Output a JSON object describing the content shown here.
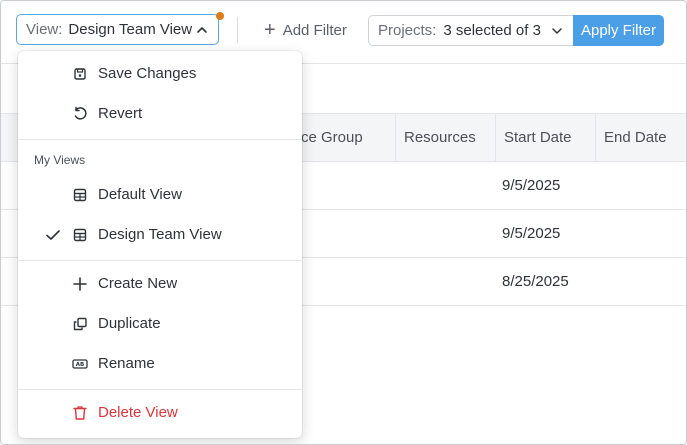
{
  "toolbar": {
    "view_prefix": "View:",
    "view_value": "Design Team View",
    "add_filter_label": "Add Filter",
    "projects_prefix": "Projects:",
    "projects_value": "3 selected of 3",
    "apply_label": "Apply Filter"
  },
  "table": {
    "columns": {
      "group": "ce Group",
      "resources": "Resources",
      "start_date": "Start Date",
      "end_date": "End Date"
    },
    "rows": [
      {
        "start_date": "9/5/2025"
      },
      {
        "start_date": "9/5/2025"
      },
      {
        "start_date": "8/25/2025"
      }
    ]
  },
  "menu": {
    "save_changes": "Save Changes",
    "revert": "Revert",
    "section_label": "My Views",
    "default_view": "Default View",
    "design_team_view": "Design Team View",
    "create_new": "Create New",
    "duplicate": "Duplicate",
    "rename": "Rename",
    "delete_view": "Delete View"
  },
  "colors": {
    "accent": "#4a9fe6",
    "unsaved_dot": "#e07b1a",
    "danger": "#d9363e"
  }
}
